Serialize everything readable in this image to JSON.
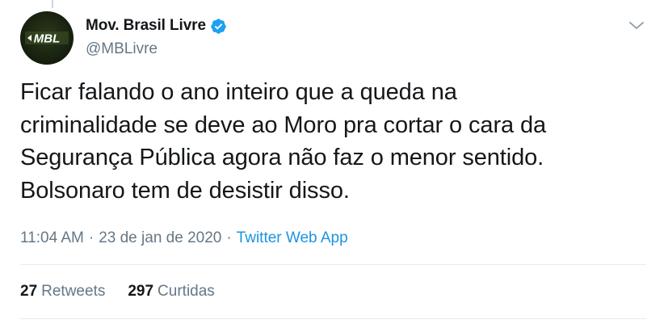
{
  "author": {
    "display_name": "Mov. Brasil Livre",
    "handle": "@MBLivre",
    "avatar_text": "MBL",
    "avatar_icon": "mbl-logo-avatar",
    "verified_icon": "verified-badge-icon"
  },
  "tweet": {
    "text": "Ficar falando o ano inteiro que a queda na\ncriminalidade se deve ao Moro pra cortar o cara da\nSegurança Pública agora não faz o menor sentido.\nBolsonaro tem de desistir disso.",
    "time": "11:04 AM",
    "separator": "·",
    "date": "23 de jan de 2020",
    "source": "Twitter Web App"
  },
  "stats": {
    "retweets_count": "27",
    "retweets_label": "Retweets",
    "likes_count": "297",
    "likes_label": "Curtidas"
  },
  "menu": {
    "icon": "chevron-down-icon"
  },
  "colors": {
    "text": "#14171a",
    "secondary": "#657786",
    "link": "#1b95e0",
    "verified": "#1da1f2",
    "divider": "#e6ecf0"
  }
}
